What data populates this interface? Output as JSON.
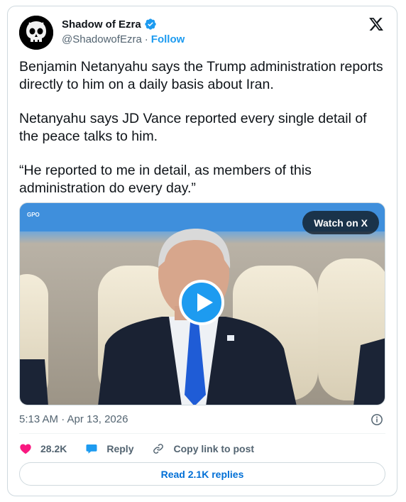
{
  "author": {
    "name": "Shadow of Ezra",
    "handle": "@ShadowofEzra",
    "separator": "·",
    "follow_label": "Follow",
    "verified_icon": "verified-badge-icon"
  },
  "brand_icon": "x-logo-icon",
  "tweet": {
    "paragraphs": [
      "Benjamin Netanyahu says the Trump administration reports directly to him on a daily basis about Iran.",
      "Netanyahu says JD Vance reported every single detail of the peace talks to him.",
      "“He reported to me in detail, as members of this administration do every day.”"
    ]
  },
  "media": {
    "watch_label": "Watch on X",
    "watermark": "GPO",
    "play_icon": "play-icon"
  },
  "meta": {
    "timestamp": "5:13 AM · Apr 13, 2026",
    "info_icon": "info-icon"
  },
  "actions": {
    "like_count": "28.2K",
    "reply_label": "Reply",
    "copy_label": "Copy link to post"
  },
  "replies_button": "Read 2.1K replies",
  "colors": {
    "accent": "#1d9bf0",
    "like": "#f91880",
    "text": "#0f1419",
    "muted": "#536471",
    "link": "#006fd6"
  }
}
